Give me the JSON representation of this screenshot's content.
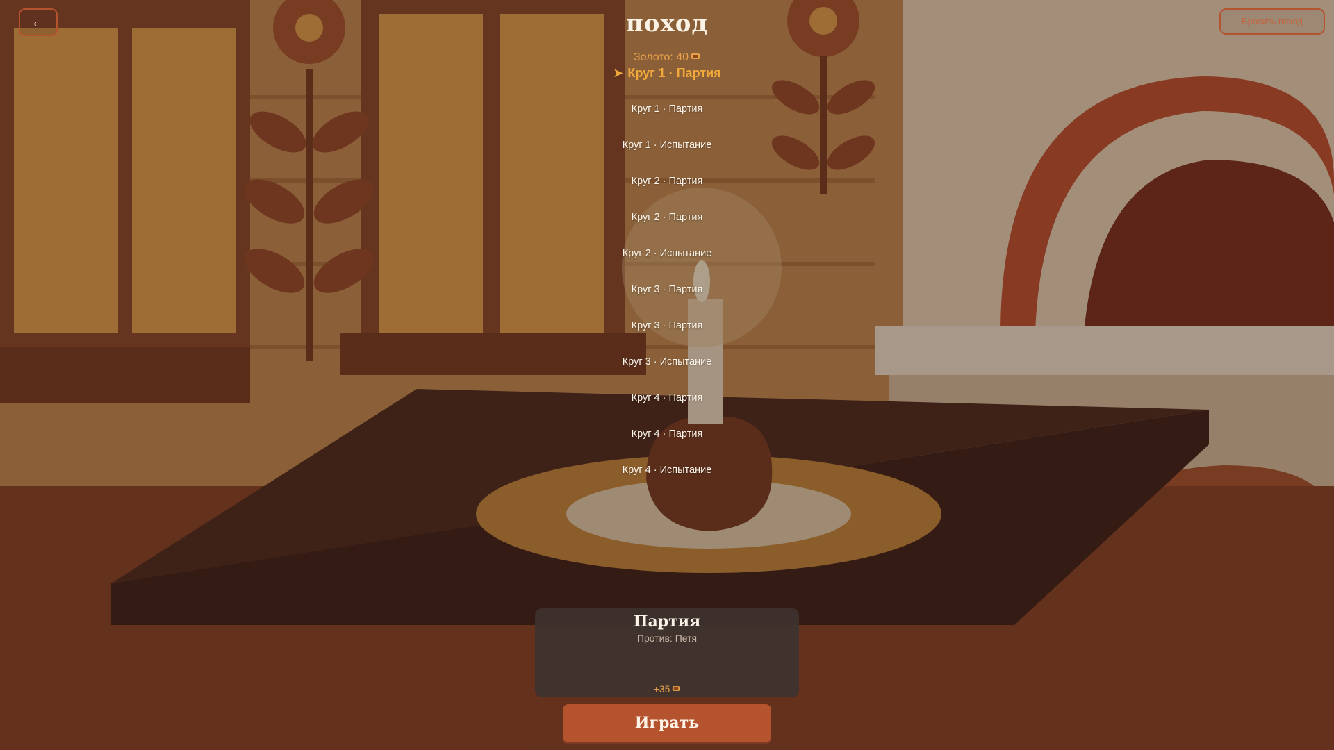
{
  "header": {
    "back_icon": "←",
    "title": "поход",
    "abandon_label": "Бросить поход"
  },
  "status": {
    "gold_text": "Золото: 40",
    "coin_icon": "coin-icon",
    "current_stage_marker": "➤",
    "current_stage": "Круг 1 · Партия"
  },
  "stages": [
    "Круг 1 · Партия",
    "Круг 1 · Испытание",
    "Круг 2 · Партия",
    "Круг 2 · Партия",
    "Круг 2 · Испытание",
    "Круг 3 · Партия",
    "Круг 3 · Партия",
    "Круг 3 · Испытание",
    "Круг 4 · Партия",
    "Круг 4 · Партия",
    "Круг 4 · Испытание"
  ],
  "card": {
    "title": "Партия",
    "opponent": "Против: Петя",
    "reward": "+35"
  },
  "play_label": "Играть",
  "colors": {
    "accent": "#b5532f",
    "gold": "#e9a24a",
    "current_stage": "#f2a93b",
    "text_light": "#fbf3e6"
  }
}
